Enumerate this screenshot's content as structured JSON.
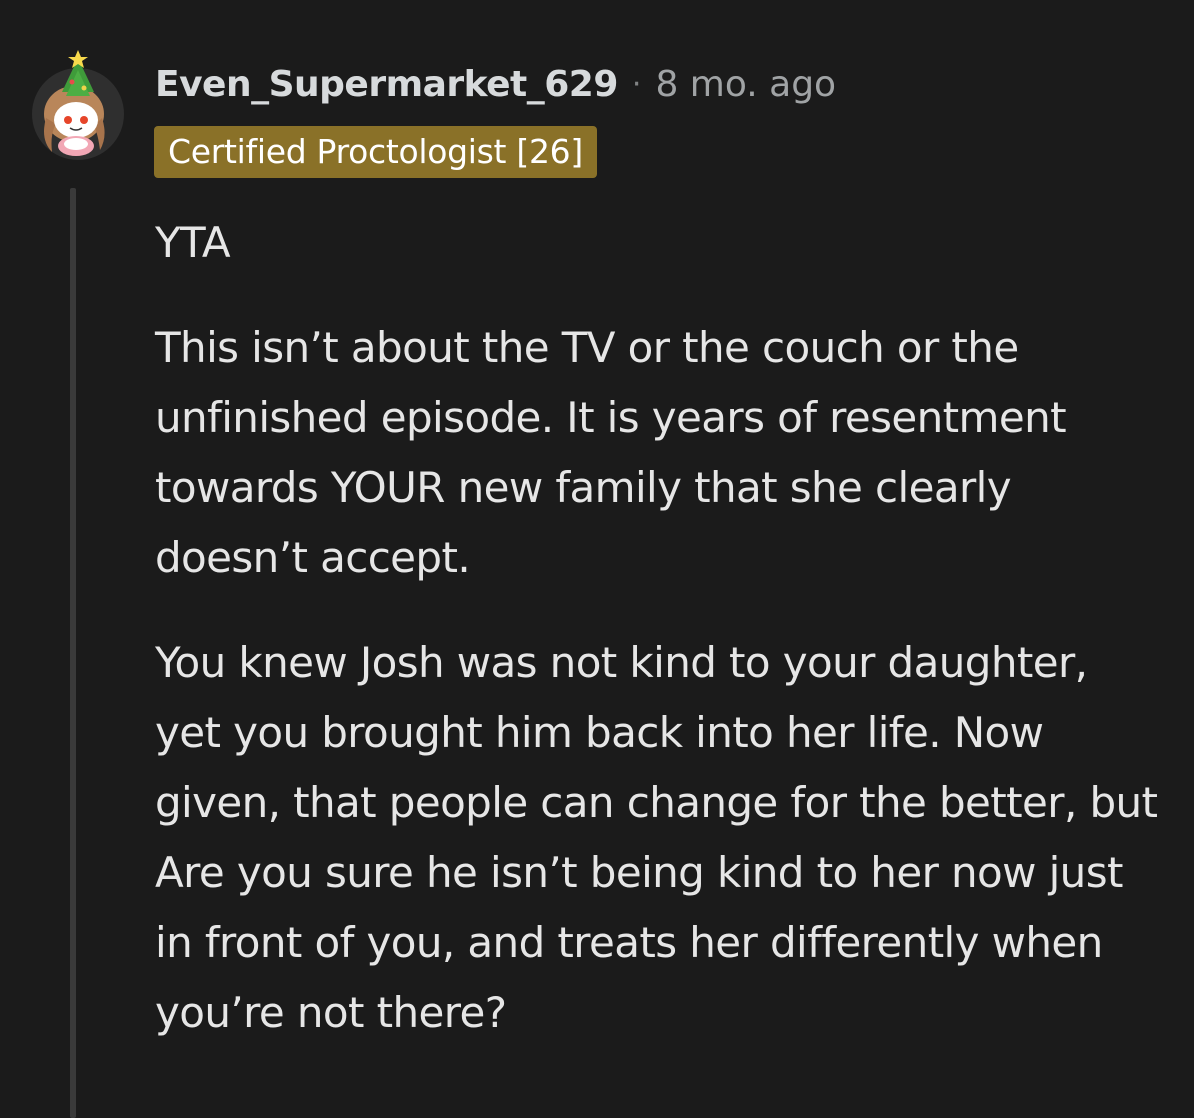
{
  "comment": {
    "username": "Even_Supermarket_629",
    "separator": "·",
    "timestamp": "8 mo. ago",
    "flair": "Certified Proctologist [26]",
    "paragraphs": [
      "YTA",
      "This isn’t about the TV or the couch or the unfinished episode. It is years of resentment towards YOUR new family that she clearly doesn’t accept.",
      "You knew Josh was not kind to your daughter, yet you brought him back into her life. Now given, that people can change for the better, but Are you sure he isn’t being kind to her now just in front of you, and treats her differently when you’re not there?"
    ]
  },
  "avatar": {
    "icon": "snoo-avatar-icon",
    "accessory": "christmas-tree-hat"
  },
  "colors": {
    "background": "#1b1b1b",
    "flair_background": "#8a7128",
    "thread_line": "#3a3a3a"
  }
}
